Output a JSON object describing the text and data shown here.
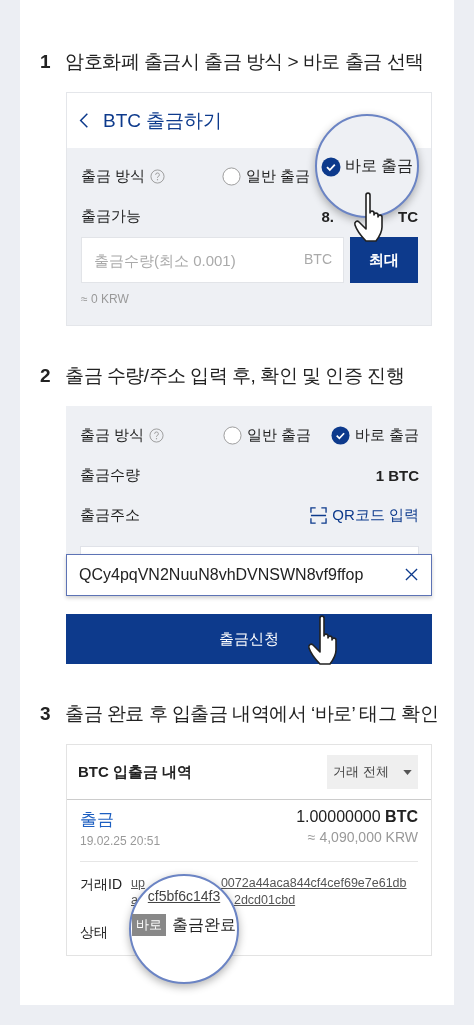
{
  "steps": [
    {
      "number": "1",
      "title": "암호화폐 출금시 출금 방식 > 바로 출금 선택",
      "kind": "method_select",
      "header_title": "BTC 출금하기",
      "method_label": "출금 방식",
      "options": [
        {
          "label": "일반 출금",
          "selected": false
        }
      ],
      "available_label": "출금가능",
      "available_value_parts": [
        "8.",
        "TC"
      ],
      "amount_field": {
        "placeholder": "출금수량(최소 0.001)",
        "unit": "BTC"
      },
      "max_button": "최대",
      "krw_estimate": "≈ 0 KRW",
      "magnifier": {
        "option": {
          "label": "바로 출금",
          "selected": true
        }
      }
    },
    {
      "number": "2",
      "title": "출금 수량/주소 입력 후, 확인 및 인증 진행",
      "kind": "address_entry",
      "method_label": "출금 방식",
      "options": [
        {
          "label": "일반 출금",
          "selected": false
        },
        {
          "label": "바로 출금",
          "selected": true
        }
      ],
      "amount_label": "출금수량",
      "amount_value": "1 BTC",
      "address_label": "출금주소",
      "qr_link": "QR코드 입력",
      "address_field": {
        "value": "QCy4pqVN2NuuN8vhDVNSWN8vf9ffop"
      },
      "submit_button": "출금신청"
    },
    {
      "number": "3",
      "title": "출금 완료 후 입출금 내역에서 ‘바로’ 태그 확인",
      "kind": "history",
      "header_title": "BTC 입출금 내역",
      "filter": "거래 전체",
      "entry": {
        "type": "출금",
        "time": "19.02.25 20:51",
        "amount": "1.00000000 **BTC**",
        "krw": "≈ 4,090,000 KRW",
        "tx_label": "거래ID",
        "tx_visible": [
          [
            "up",
            "0072a44aca844cf4cef69e7e61db"
          ],
          [
            "a",
            "2dcd01cbd"
          ]
        ],
        "status_label": "상태"
      },
      "magnifier": {
        "tx_fragment": "cf5bf6c14f3",
        "tag": "바로",
        "status": "출금완료"
      }
    }
  ]
}
